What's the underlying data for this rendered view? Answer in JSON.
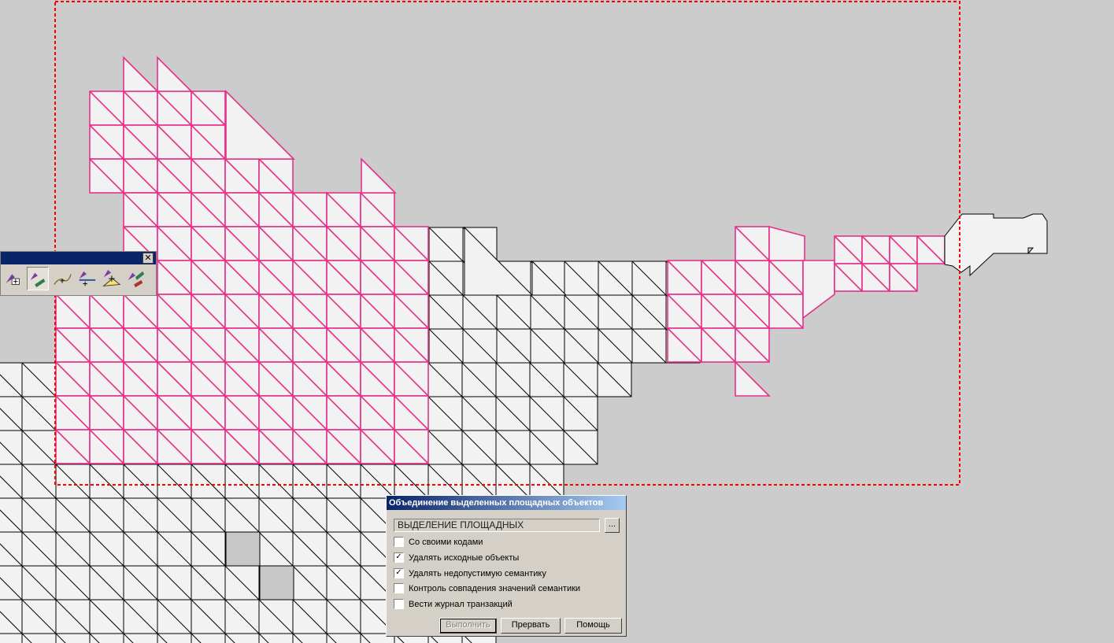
{
  "colors": {
    "background": "#cccccc",
    "cell_fill": "#f2f2f2",
    "grid_line": "#000000",
    "selection_line": "#e6308a",
    "frame_dash": "#ff0000"
  },
  "toolbar": {
    "close_label": "✕",
    "buttons": [
      "merge-areas-icon",
      "merge-selected-icon",
      "split-line-icon",
      "join-line-icon",
      "area-tool-icon",
      "delete-object-icon"
    ]
  },
  "dialog": {
    "title": "Объединение выделенных площадных объектов",
    "combo_value": "ВЫДЕЛЕНИЕ ПЛОЩАДНЫХ",
    "browse_label": "...",
    "options": [
      {
        "label": "Со своими кодами",
        "checked": false
      },
      {
        "label": "Удалять исходные объекты",
        "checked": true
      },
      {
        "label": "Удалять недопустимую семантику",
        "checked": true
      },
      {
        "label": "Контроль совпадения значений семантики",
        "checked": false
      },
      {
        "label": "Вести журнал транзакций",
        "checked": false
      }
    ],
    "buttons": {
      "run": "Выполнить",
      "abort": "Прервать",
      "help": "Помощь"
    }
  }
}
